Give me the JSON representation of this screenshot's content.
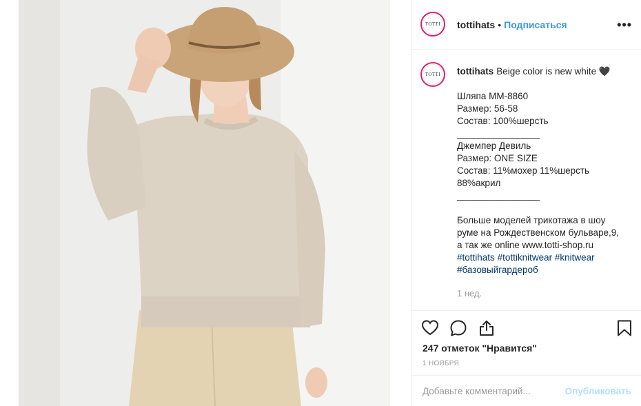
{
  "post": {
    "username": "tottihats",
    "avatar_text": "TOTTI",
    "separator": "•",
    "follow_label": "Подписаться",
    "more_label": "•••"
  },
  "caption": {
    "username": "tottihats",
    "first_line": "Beige color is new white 🖤",
    "hat_block": [
      "Шляпа ММ-8860",
      "Размер: 56-58",
      "Состав: 100%шерсть"
    ],
    "divider_1": "________________",
    "sweater_block": [
      "Джемпер Девиль",
      "Размер: ONE SIZE",
      "Состав: 11%мохер 11%шерсть 88%акрил"
    ],
    "divider_2": "________________",
    "info_text": "Больше моделей трикотажа в шоу руме на Рождественском бульваре,9, а так же online www.totti-shop.ru",
    "hashtags": [
      "#tottihats",
      "#tottiknitwear",
      "#knitwear",
      "#базовыйгардероб"
    ],
    "time_ago": "1 нед."
  },
  "actions": {
    "like_icon": "heart-icon",
    "comment_icon": "comment-icon",
    "share_icon": "share-icon",
    "save_icon": "bookmark-icon",
    "likes_text": "247 отметок \"Нравится\"",
    "date_text": "1 ноября"
  },
  "comment": {
    "placeholder": "Добавьте комментарий...",
    "publish_label": "Опубликовать"
  }
}
